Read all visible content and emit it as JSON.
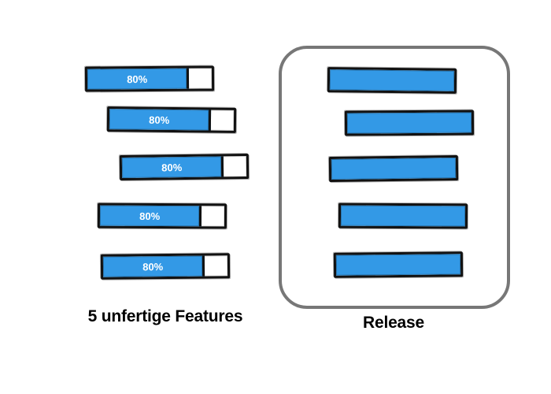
{
  "left": {
    "caption": "5 unfertige Features",
    "bars": [
      {
        "percent": 80,
        "label": "80%"
      },
      {
        "percent": 80,
        "label": "80%"
      },
      {
        "percent": 80,
        "label": "80%"
      },
      {
        "percent": 80,
        "label": "80%"
      },
      {
        "percent": 80,
        "label": "80%"
      }
    ]
  },
  "right": {
    "caption": "Release",
    "bars": [
      {
        "percent": 100
      },
      {
        "percent": 100
      },
      {
        "percent": 100
      },
      {
        "percent": 100
      },
      {
        "percent": 100
      }
    ]
  },
  "colors": {
    "fill": "#3399e6",
    "stroke": "#111111",
    "boxStroke": "#777777"
  }
}
